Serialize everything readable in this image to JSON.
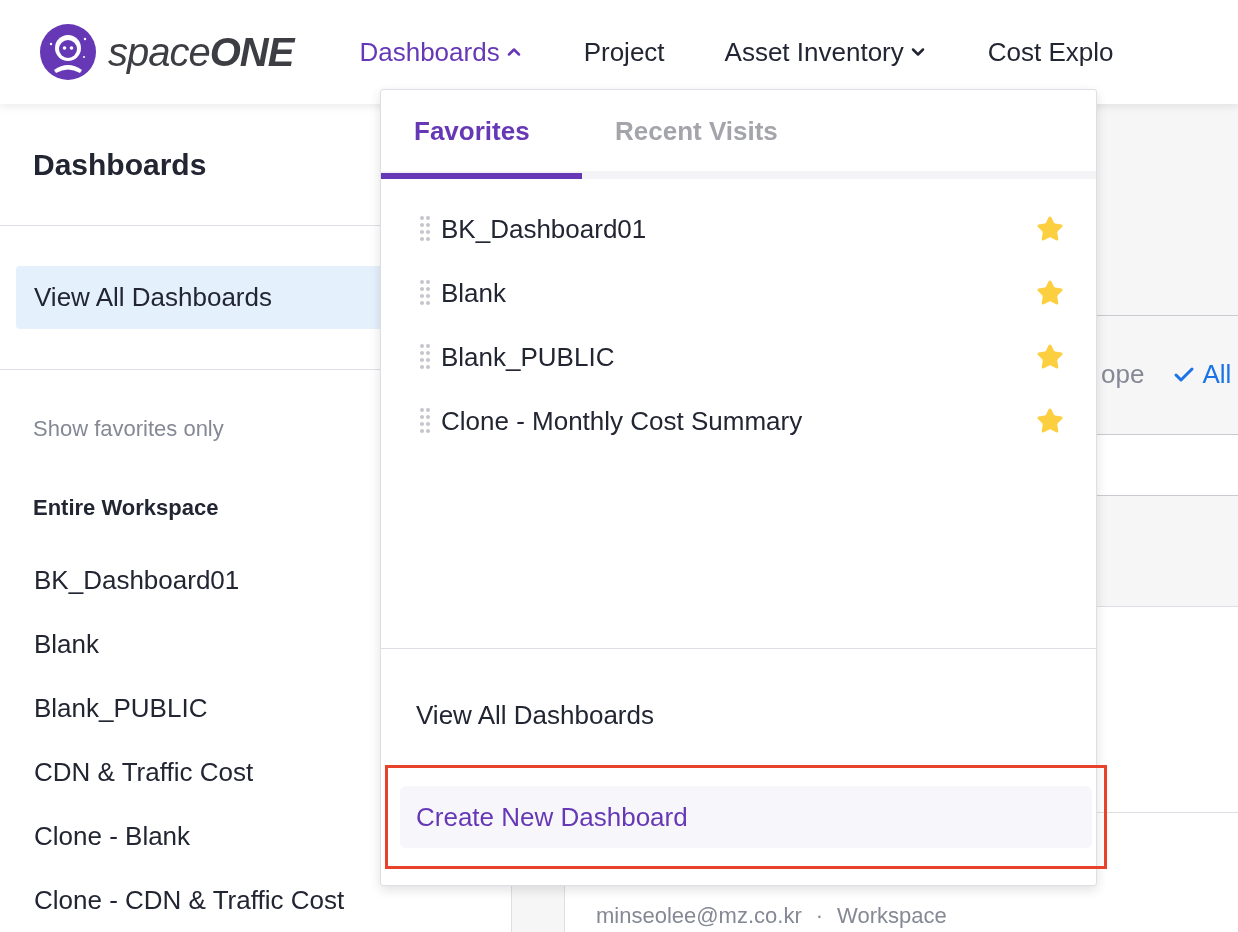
{
  "logo": {
    "light": "space",
    "bold": "ONE"
  },
  "nav": [
    {
      "label": "Dashboards",
      "kind": "dropdown",
      "selected": true,
      "expanded": true
    },
    {
      "label": "Project",
      "kind": "link",
      "selected": false
    },
    {
      "label": "Asset Inventory",
      "kind": "dropdown",
      "selected": false,
      "expanded": false
    },
    {
      "label": "Cost Explo",
      "kind": "link",
      "selected": false
    }
  ],
  "sidebar": {
    "title": "Dashboards",
    "items": [
      {
        "label": "View All Dashboards",
        "selected": true
      }
    ],
    "toggle": "Show favorites only",
    "section": "Entire Workspace",
    "dashboards": [
      "BK_Dashboard01",
      "Blank",
      "Blank_PUBLIC",
      "CDN & Traffic Cost",
      "Clone - Blank",
      "Clone - CDN & Traffic Cost"
    ]
  },
  "dropdown": {
    "tabs": [
      {
        "label": "Favorites",
        "selected": true
      },
      {
        "label": "Recent Visits",
        "selected": false
      }
    ],
    "favorites": [
      {
        "label": "BK_Dashboard01",
        "favorite": true
      },
      {
        "label": "Blank",
        "favorite": true
      },
      {
        "label": "Blank_PUBLIC",
        "favorite": true
      },
      {
        "label": "Clone - Monthly Cost Summary",
        "favorite": true
      }
    ],
    "footer": [
      {
        "label": "View All Dashboards",
        "kind": "link",
        "highlighted": false
      },
      {
        "label": "Create New Dashboard",
        "kind": "create",
        "highlighted": true
      }
    ]
  },
  "filter": {
    "label": "ope",
    "option": "All",
    "checked": true
  },
  "owner": {
    "email": "minseolee@mz.co.kr",
    "separator": "·",
    "scope": "Workspace"
  }
}
